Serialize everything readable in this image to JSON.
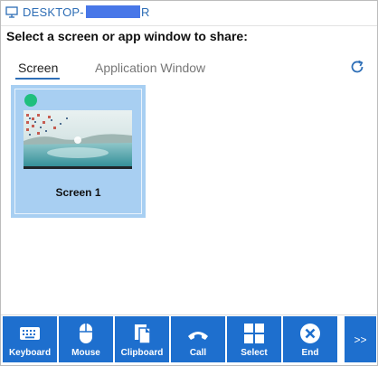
{
  "window": {
    "title_prefix": "DESKTOP-",
    "title_suffix": "R",
    "icon": "monitor-icon"
  },
  "prompt": "Select a screen or app window to share:",
  "tabs": [
    {
      "label": "Screen",
      "selected": true
    },
    {
      "label": "Application Window",
      "selected": false
    }
  ],
  "refresh_icon": "refresh-icon",
  "screens": [
    {
      "label": "Screen 1",
      "selected": true,
      "status_color": "#1fbf7e"
    }
  ],
  "toolbar": {
    "buttons": [
      {
        "label": "Keyboard",
        "icon": "keyboard-icon"
      },
      {
        "label": "Mouse",
        "icon": "mouse-icon"
      },
      {
        "label": "Clipboard",
        "icon": "clipboard-icon"
      },
      {
        "label": "Call",
        "icon": "phone-icon"
      },
      {
        "label": "Select",
        "icon": "grid-icon"
      },
      {
        "label": "End",
        "icon": "close-circle-icon"
      }
    ],
    "more_label": ">>"
  },
  "colors": {
    "accent": "#1e6fce",
    "title_text": "#2d6db5",
    "tile_bg": "#a8cff2",
    "redaction": "#4877e8"
  }
}
